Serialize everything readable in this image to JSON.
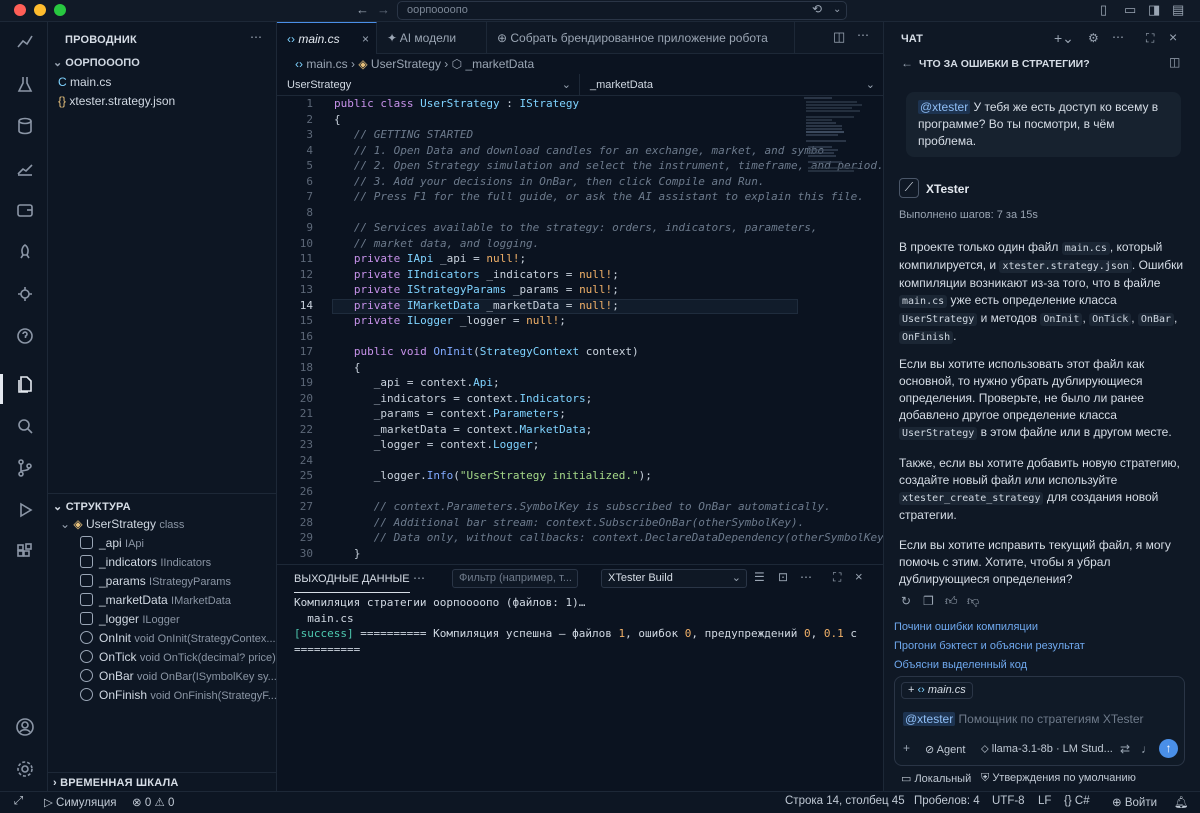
{
  "window": {
    "command_center": "оорпоооопо"
  },
  "explorer": {
    "header": "ПРОВОДНИК",
    "project": "ООРПОООПО",
    "files": [
      {
        "name": "main.cs",
        "icon": "csharp-file-icon"
      },
      {
        "name": "xtester.strategy.json",
        "icon": "json-file-icon"
      }
    ]
  },
  "outline": {
    "header": "СТРУКТУРА",
    "class_name": "UserStrategy",
    "class_kind": "class",
    "members": [
      {
        "name": "_api",
        "type": "IApi",
        "kind": "field"
      },
      {
        "name": "_indicators",
        "type": "IIndicators",
        "kind": "field"
      },
      {
        "name": "_params",
        "type": "IStrategyParams",
        "kind": "field"
      },
      {
        "name": "_marketData",
        "type": "IMarketData",
        "kind": "field"
      },
      {
        "name": "_logger",
        "type": "ILogger",
        "kind": "field"
      },
      {
        "name": "OnInit",
        "type": "void OnInit(StrategyContex...",
        "kind": "method"
      },
      {
        "name": "OnTick",
        "type": "void OnTick(decimal? price)",
        "kind": "method"
      },
      {
        "name": "OnBar",
        "type": "void OnBar(ISymbolKey sy...",
        "kind": "method"
      },
      {
        "name": "OnFinish",
        "type": "void OnFinish(StrategyF...",
        "kind": "method"
      }
    ],
    "timeline": "ВРЕМЕННАЯ ШКАЛА"
  },
  "editor": {
    "tabs": [
      {
        "label": "main.cs",
        "icon": "braces-icon"
      },
      {
        "label": "AI модели",
        "icon": "sparkle-icon"
      },
      {
        "label": "Собрать брендированное приложение робота",
        "icon": "globe-icon"
      }
    ],
    "breadcrumb": [
      "main.cs",
      "UserStrategy",
      "_marketData"
    ],
    "class_select": "UserStrategy",
    "member_select": "_marketData",
    "current_line": 14,
    "lines": [
      {
        "n": "1",
        "html": "<span class='kw'>public class</span> <span class='ty'>UserStrategy</span> : <span class='ty'>IStrategy</span>"
      },
      {
        "n": "2",
        "html": "{"
      },
      {
        "n": "3",
        "html": "   <span class='cm'>// GETTING STARTED</span>"
      },
      {
        "n": "4",
        "html": "   <span class='cm'>// 1. Open Data and download candles for an exchange, market, and symbo</span>"
      },
      {
        "n": "5",
        "html": "   <span class='cm'>// 2. Open Strategy simulation and select the instrument, timeframe, and period.</span>"
      },
      {
        "n": "6",
        "html": "   <span class='cm'>// 3. Add your decisions in OnBar, then click Compile and Run.</span>"
      },
      {
        "n": "7",
        "html": "   <span class='cm'>// Press F1 for the full guide, or ask the AI assistant to explain this file.</span>"
      },
      {
        "n": "8",
        "html": ""
      },
      {
        "n": "9",
        "html": "   <span class='cm'>// Services available to the strategy: orders, indicators, parameters,</span>"
      },
      {
        "n": "10",
        "html": "   <span class='cm'>// market data, and logging.</span>"
      },
      {
        "n": "11",
        "html": "   <span class='kw'>private</span> <span class='ty'>IApi</span> _api = <span class='nu'>null!</span>;"
      },
      {
        "n": "12",
        "html": "   <span class='kw'>private</span> <span class='ty'>IIndicators</span> _indicators = <span class='nu'>null!</span>;"
      },
      {
        "n": "13",
        "html": "   <span class='kw'>private</span> <span class='ty'>IStrategyParams</span> _params = <span class='nu'>null!</span>;"
      },
      {
        "n": "14",
        "html": "   <span class='kw'>private</span> <span class='ty'>IMarketData</span> _marketData = <span class='nu'>null!</span>;"
      },
      {
        "n": "15",
        "html": "   <span class='kw'>private</span> <span class='ty'>ILogger</span> _logger = <span class='nu'>null!</span>;"
      },
      {
        "n": "16",
        "html": ""
      },
      {
        "n": "17",
        "html": "   <span class='kw'>public void</span> <span class='fn'>OnInit</span>(<span class='ty'>StrategyContext</span> context)"
      },
      {
        "n": "18",
        "html": "   {"
      },
      {
        "n": "19",
        "html": "      _api = context.<span class='ty'>Api</span>;"
      },
      {
        "n": "20",
        "html": "      _indicators = context.<span class='ty'>Indicators</span>;"
      },
      {
        "n": "21",
        "html": "      _params = context.<span class='ty'>Parameters</span>;"
      },
      {
        "n": "22",
        "html": "      _marketData = context.<span class='ty'>MarketData</span>;"
      },
      {
        "n": "23",
        "html": "      _logger = context.<span class='ty'>Logger</span>;"
      },
      {
        "n": "24",
        "html": ""
      },
      {
        "n": "25",
        "html": "      _logger.<span class='fn'>Info</span>(<span class='st'>\"UserStrategy initialized.\"</span>);"
      },
      {
        "n": "26",
        "html": ""
      },
      {
        "n": "27",
        "html": "      <span class='cm'>// context.Parameters.SymbolKey is subscribed to OnBar automatically.</span>"
      },
      {
        "n": "28",
        "html": "      <span class='cm'>// Additional bar stream: context.SubscribeOnBar(otherSymbolKey).</span>"
      },
      {
        "n": "29",
        "html": "      <span class='cm'>// Data only, without callbacks: context.DeclareDataDependency(otherSymbolKey).</span>"
      },
      {
        "n": "30",
        "html": "   }"
      }
    ]
  },
  "panel": {
    "tab": "ВЫХОДНЫЕ ДАННЫЕ",
    "filter_placeholder": "Фильтр (например, т...",
    "channel": "XTester Build",
    "output": [
      "Компиляция стратегии оорпоооопо (файлов: 1)…",
      "  main.cs",
      "[success] ========== Компиляция успешна — файлов 1, ошибок 0, предупреждений 0, 0.1 с",
      "=========="
    ]
  },
  "chat": {
    "header": "ЧАТ",
    "title": "ЧТО ЗА ОШИБКИ В СТРАТЕГИИ?",
    "user_mention": "@xtester",
    "user_text": " У тебя же есть доступ ко всему в программе? Во ты посмотри, в чём проблема.",
    "agent_name": "XTester",
    "steps": "Выполнено шагов: 7 за 15s",
    "p1": "В проекте только один файл <span class='code'>main.cs</span>, который компилируется, и <span class='code'>xtester.strategy.json</span>. Ошибки компиляции возникают из-за того, что в файле <span class='code'>main.cs</span> уже есть определение класса <span class='code'>UserStrategy</span> и методов <span class='code'>OnInit</span>, <span class='code'>OnTick</span>, <span class='code'>OnBar</span>, <span class='code'>OnFinish</span>.",
    "p2": "Если вы хотите использовать этот файл как основной, то нужно убрать дублирующиеся определения. Проверьте, не было ли ранее добавлено другое определение класса <span class='code'>UserStrategy</span> в этом файле или в другом месте.",
    "p3": "Также, если вы хотите добавить новую стратегию, создайте новый файл или используйте <span class='code'>xtester_create_strategy</span> для создания новой стратегии.",
    "p4": "Если вы хотите исправить текущий файл, я могу помочь с этим. Хотите, чтобы я убрал дублирующиеся определения?",
    "suggestions": [
      "Почини ошибки компиляции",
      "Прогони бэктест и объясни результат",
      "Объясни выделенный код"
    ],
    "context_file": "main.cs",
    "input_mention": "@xtester",
    "input_placeholder": "Помощник по стратегиям XTester",
    "mode": "Agent",
    "model": "llama-3.1-8b · LM Stud...",
    "location": "Локальный",
    "approvals": "Утверждения по умолчанию"
  },
  "statusbar": {
    "sim": "Симуляция",
    "errors": "0",
    "warnings": "0",
    "position": "Строка 14, столбец 45",
    "spaces": "Пробелов: 4",
    "encoding": "UTF-8",
    "eol": "LF",
    "lang": "C#",
    "login": "Войти"
  },
  "colors": {
    "accent": "#4a8fe7",
    "success": "#4ec9b0",
    "link": "#6fa8ee"
  }
}
